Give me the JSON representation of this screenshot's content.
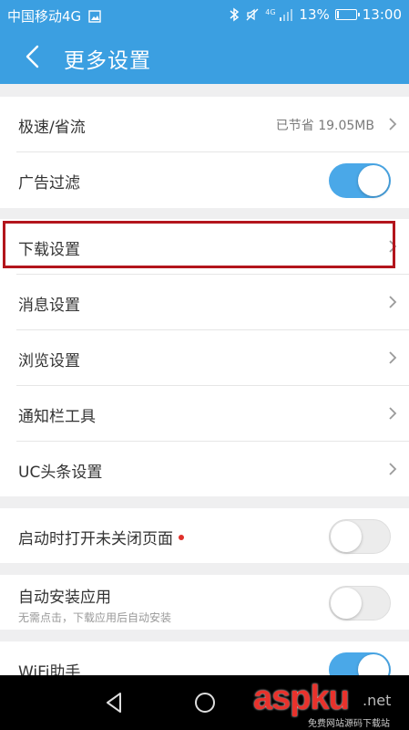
{
  "status_bar": {
    "carrier": "中国移动4G",
    "network_badge": "4G",
    "battery": "13%",
    "battery_level": 0.13,
    "time": "13:00",
    "icons": [
      "image-icon",
      "bluetooth-icon",
      "mute-icon",
      "signal-icon",
      "battery-icon"
    ]
  },
  "header": {
    "back_icon": "back-arrow-icon",
    "title": "更多设置"
  },
  "groups": {
    "speed": {
      "label": "极速/省流",
      "value": "已节省 19.05MB",
      "ad_filter_label": "广告过滤",
      "ad_filter_on": true
    },
    "settings": {
      "download": "下载设置",
      "message": "消息设置",
      "browse": "浏览设置",
      "notify_tools": "通知栏工具",
      "uc_headline": "UC头条设置"
    },
    "startup": {
      "label": "启动时打开未关闭页面",
      "on": false
    },
    "auto_install": {
      "label": "自动安装应用",
      "sub": "无需点击，下载应用后自动安装",
      "on": false
    },
    "wifi": {
      "label": "WiFi助手",
      "on": true
    }
  },
  "watermark": {
    "logo": "aspku",
    "domain": ".net",
    "caption": "免费网站源码下载站"
  },
  "colors": {
    "accent": "#3b9fe1",
    "toggle_on": "#4aa8e8",
    "highlight": "#b3151c"
  }
}
